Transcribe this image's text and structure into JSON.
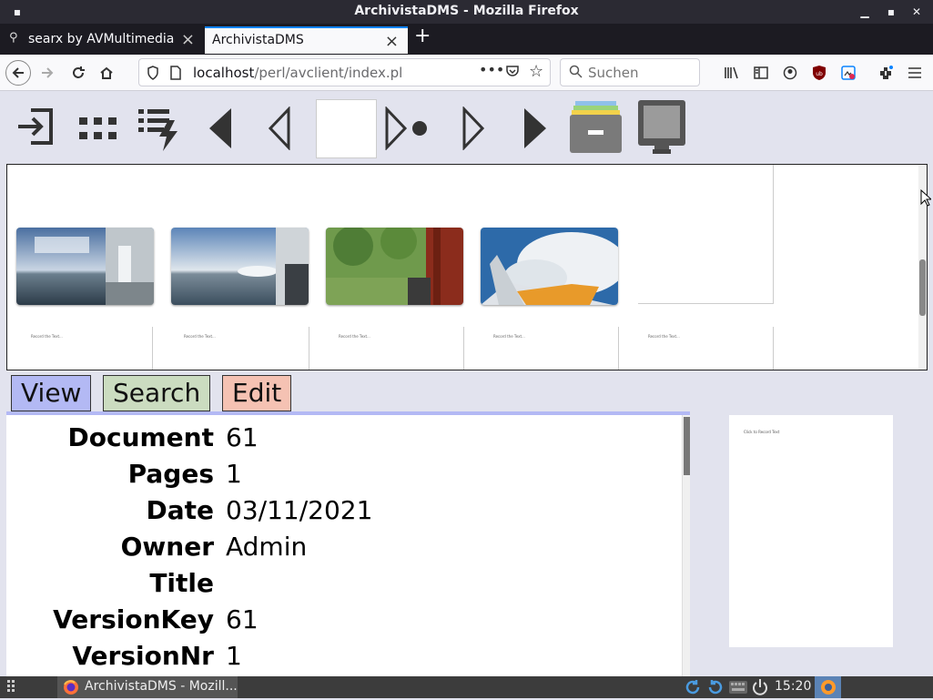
{
  "window": {
    "title": "ArchivistaDMS - Mozilla Firefox"
  },
  "browser": {
    "tabs": [
      {
        "label": "searx by AVMultimedia"
      },
      {
        "label": "ArchivistaDMS"
      }
    ],
    "url_host": "localhost",
    "url_path": "/perl/avclient/index.pl",
    "search_placeholder": "Suchen"
  },
  "thumbnails": {
    "page_label": "Record the Text..."
  },
  "mode_tabs": {
    "view": "View",
    "search": "Search",
    "edit": "Edit"
  },
  "colors": {
    "view": "#b3b9f4",
    "search": "#cbdcc0",
    "edit": "#f5c2b3"
  },
  "details": [
    {
      "key": "Document",
      "value": "61"
    },
    {
      "key": "Pages",
      "value": "1"
    },
    {
      "key": "Date",
      "value": "03/11/2021"
    },
    {
      "key": "Owner",
      "value": "Admin"
    },
    {
      "key": "Title",
      "value": ""
    },
    {
      "key": "VersionKey",
      "value": "61"
    },
    {
      "key": "VersionNr",
      "value": "1"
    }
  ],
  "preview": {
    "text": "Click to Record Text"
  },
  "taskbar": {
    "app_label": "ArchivistaDMS - Mozill...",
    "clock": "15:20"
  }
}
